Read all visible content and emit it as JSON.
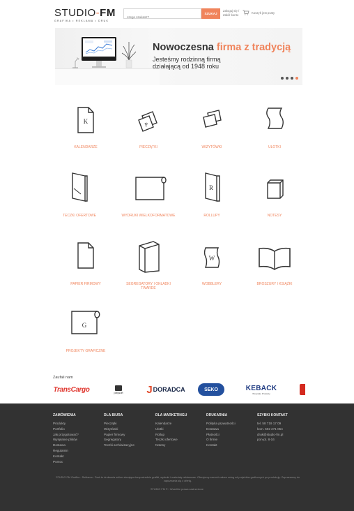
{
  "header": {
    "logo_text": "STUDIO",
    "logo_dash": "-",
    "logo_fm": "FM",
    "logo_tagline": "GRAFIKA • REKLAMA • DRUK",
    "search_placeholder": "czego szukasz?",
    "search_button": "SZUKAJ",
    "login_label": "Zaloguj się / Załóż konto",
    "cart_label": "Koszyk jest pusty",
    "cart_icon": "cart-icon"
  },
  "banner": {
    "title_part1": "Nowoczesna ",
    "title_accent": "firma z tradycją",
    "subtitle": "Jesteśmy rodzinną firmą działającą od 1948 roku",
    "active_slide": 4,
    "slides": 4
  },
  "categories": [
    {
      "label": "KALENDARZE",
      "icon": "calendar-k-icon"
    },
    {
      "label": "PIECZĄTKI",
      "icon": "stamp-p-icon"
    },
    {
      "label": "WIZYTÓWKI",
      "icon": "business-cards-icon"
    },
    {
      "label": "ULOTKI",
      "icon": "leaflet-icon"
    },
    {
      "label": "TECZKI OFERTOWE",
      "icon": "folder-icon"
    },
    {
      "label": "WYDRUKI WIELKOFORMATOWE",
      "icon": "large-format-icon"
    },
    {
      "label": "ROLLUPY",
      "icon": "rollup-r-icon"
    },
    {
      "label": "NOTESY",
      "icon": "notepad-icon"
    },
    {
      "label": "PAPIER FIRMOWY",
      "icon": "letterhead-icon"
    },
    {
      "label": "SEGREGATORY I OKŁADKI TWARDE",
      "icon": "binder-icon"
    },
    {
      "label": "WOBBLERY",
      "icon": "wobbler-w-icon"
    },
    {
      "label": "BROSZURY I KSIĄŻKI",
      "icon": "book-icon"
    },
    {
      "label": "PROJEKTY GRAFICZNE",
      "icon": "graphic-design-g-icon"
    }
  ],
  "partners": {
    "title": "Zaufali nam",
    "items": [
      "TransCargo",
      "playsoft",
      "DORADCA",
      "SEKO",
      "KEBACK"
    ],
    "playsoft_sub": "playsoft project",
    "doradca_j": "J",
    "keback_sub": "Wszystko Produkty"
  },
  "footer": {
    "columns": [
      {
        "title": "ZAMÓWIENIA",
        "items": [
          "Produkty",
          "Portfolio",
          "Jak przygotować?",
          "Wysyłanie plików",
          "Dostawa",
          "Regulamin",
          "Kontakt",
          "Pomoc"
        ]
      },
      {
        "title": "DLA BIURA",
        "items": [
          "Pieczątki",
          "Wizytówki",
          "Papier firmowy",
          "Segregatory",
          "Teczki archiwizacyjne"
        ]
      },
      {
        "title": "DLA MARKETINGU",
        "items": [
          "Kalendarze",
          "Ulotki",
          "Rollup",
          "Teczki ofertowe",
          "Notesy"
        ]
      },
      {
        "title": "DRUKARNIA",
        "items": [
          "Polityka prywatności",
          "Dostawa",
          "Płatności",
          "O firmie",
          "Kontakt"
        ]
      },
      {
        "title": "SZYBKI KONTAKT",
        "items": [
          "tel. 58 719 17 09",
          "kom. 502 271 054",
          "druk@studio-fm.pl",
          "pon-pt. 8-16"
        ]
      }
    ],
    "note": "STUDIO FM Grafika - Reklama - Druk to drukarnia online zlecająca bezpośrednie grafiki, wydruki i materiały reklamowe. Oferujemy szeroki zakres usług od projektów graficznych po produkcję. Zapraszamy do zapoznania się z ofertą.",
    "copyright": "STUDIO FM © / Wszelkie prawa zastrzeżone"
  },
  "colors": {
    "accent": "#f0845c",
    "footer_bg": "#323232",
    "text": "#333333"
  }
}
